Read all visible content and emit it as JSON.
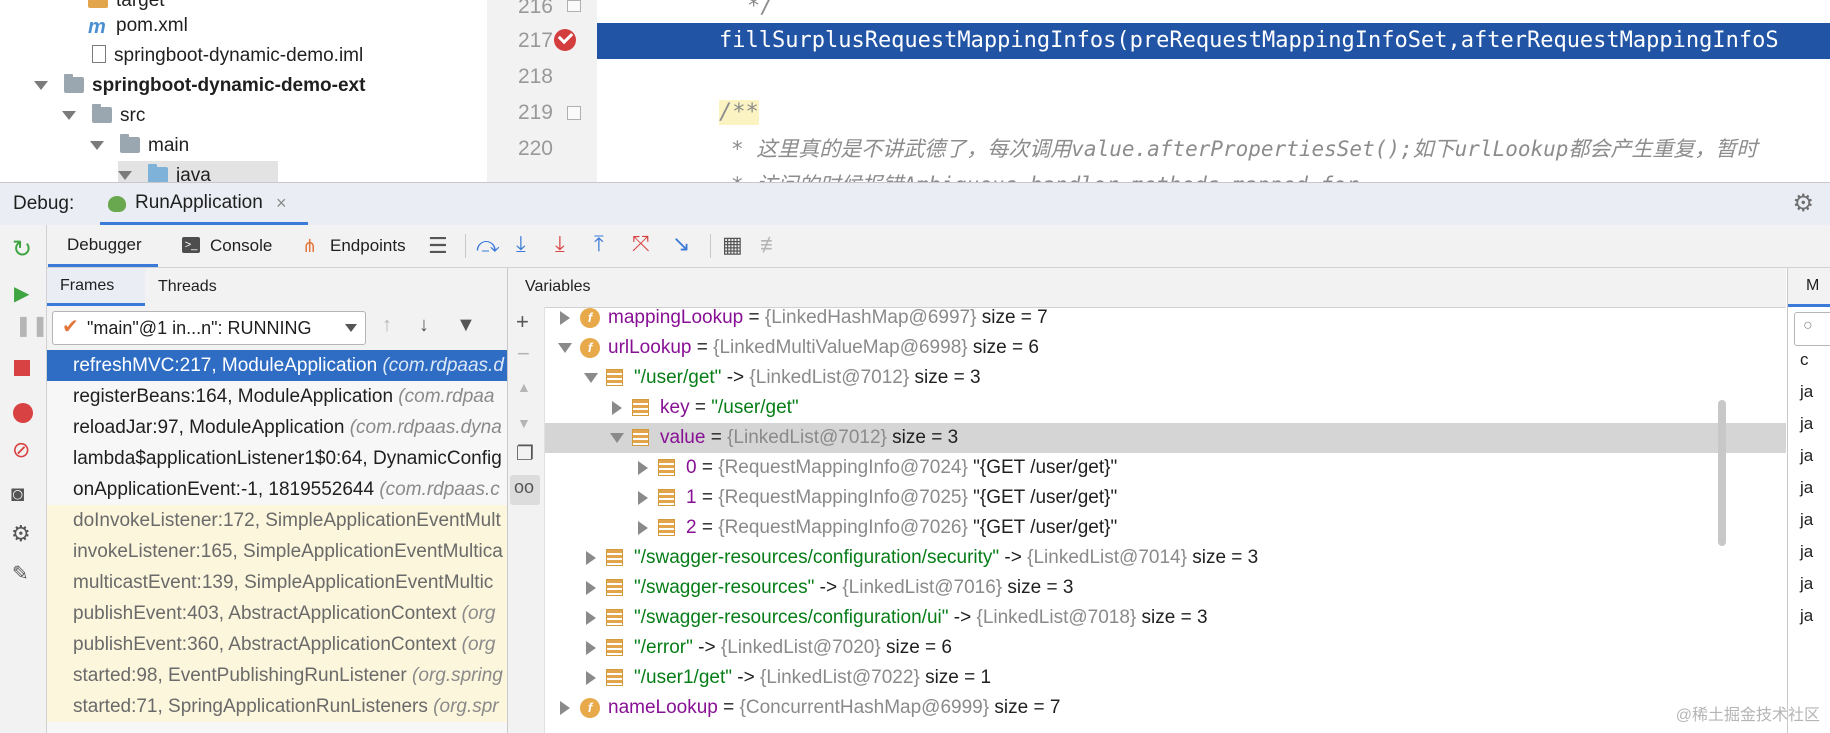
{
  "project_tree": {
    "items": [
      {
        "label": "target",
        "icon": "folder-orange-icon"
      },
      {
        "label": "pom.xml",
        "icon": "maven-icon"
      },
      {
        "label": "springboot-dynamic-demo.iml",
        "icon": "module-file-icon"
      },
      {
        "label": "springboot-dynamic-demo-ext",
        "icon": "module-folder-icon"
      },
      {
        "label": "src",
        "icon": "folder-icon"
      },
      {
        "label": "main",
        "icon": "folder-icon"
      },
      {
        "label": "java",
        "icon": "source-folder-icon"
      }
    ]
  },
  "editor": {
    "line_numbers": [
      "216",
      "217",
      "218",
      "219",
      "220"
    ],
    "lines": [
      "*/",
      "fillSurplusRequestMappingInfos(preRequestMappingInfoSet,afterRequestMappingInfoS",
      "",
      "/**",
      "* 这里真的是不讲武德了，每次调用value.afterPropertiesSet();如下urlLookup都会产生重复，暂时",
      "* 访问的时候报错Ambiguous handler methods mapped for"
    ],
    "breakpoint_line": "217"
  },
  "debug": {
    "title": "Debug:",
    "session_tab": "RunApplication",
    "tabs": [
      "Debugger",
      "Console",
      "Endpoints"
    ],
    "subtabs": [
      "Frames",
      "Threads"
    ],
    "variables_title": "Variables",
    "memory_tab": "M",
    "thread_selector": "\"main\"@1 in...n\": RUNNING"
  },
  "frames": [
    {
      "method": "refreshMVC:217, ModuleApplication",
      "pkg": "(com.rdpaas.d",
      "selected": true
    },
    {
      "method": "registerBeans:164, ModuleApplication",
      "pkg": "(com.rdpaa"
    },
    {
      "method": "reloadJar:97, ModuleApplication",
      "pkg": "(com.rdpaas.dyna"
    },
    {
      "method": "lambda$applicationListener1$0:64, DynamicConfig",
      "pkg": ""
    },
    {
      "method": "onApplicationEvent:-1, 1819552644",
      "pkg": "(com.rdpaas.c"
    },
    {
      "method": "doInvokeListener:172, SimpleApplicationEventMult",
      "pkg": "",
      "lib": true
    },
    {
      "method": "invokeListener:165, SimpleApplicationEventMultica",
      "pkg": "",
      "lib": true
    },
    {
      "method": "multicastEvent:139, SimpleApplicationEventMultic",
      "pkg": "",
      "lib": true
    },
    {
      "method": "publishEvent:403, AbstractApplicationContext",
      "pkg": "(org",
      "lib": true
    },
    {
      "method": "publishEvent:360, AbstractApplicationContext",
      "pkg": "(org",
      "lib": true
    },
    {
      "method": "started:98, EventPublishingRunListener",
      "pkg": "(org.spring",
      "lib": true
    },
    {
      "method": "started:71, SpringApplicationRunListeners",
      "pkg": "(org.spr",
      "lib": true
    }
  ],
  "variables": [
    {
      "indent": 0,
      "arrow": "right",
      "icon": "field",
      "name": "mappingLookup",
      "eq": " = ",
      "type": "{LinkedHashMap@6997}",
      "extra": "  size = 7"
    },
    {
      "indent": 0,
      "arrow": "down",
      "icon": "field",
      "name": "urlLookup",
      "eq": " = ",
      "type": "{LinkedMultiValueMap@6998}",
      "extra": "  size = 6"
    },
    {
      "indent": 1,
      "arrow": "down",
      "icon": "list",
      "str": "\"/user/get\"",
      "eq": " -> ",
      "type": "{LinkedList@7012}",
      "extra": "  size = 3"
    },
    {
      "indent": 2,
      "arrow": "right",
      "icon": "list",
      "name": "key",
      "eq": " = ",
      "str": "\"/user/get\""
    },
    {
      "indent": 2,
      "arrow": "down",
      "icon": "list",
      "name": "value",
      "eq": " = ",
      "type": "{LinkedList@7012}",
      "extra": "  size = 3",
      "selected": true
    },
    {
      "indent": 3,
      "arrow": "right",
      "icon": "list",
      "plain": "0",
      "eq": " = ",
      "type": "{RequestMappingInfo@7024}",
      "extra": " \"{GET /user/get}\""
    },
    {
      "indent": 3,
      "arrow": "right",
      "icon": "list",
      "plain": "1",
      "eq": " = ",
      "type": "{RequestMappingInfo@7025}",
      "extra": " \"{GET /user/get}\""
    },
    {
      "indent": 3,
      "arrow": "right",
      "icon": "list",
      "plain": "2",
      "eq": " = ",
      "type": "{RequestMappingInfo@7026}",
      "extra": " \"{GET /user/get}\""
    },
    {
      "indent": 1,
      "arrow": "right",
      "icon": "list",
      "str": "\"/swagger-resources/configuration/security\"",
      "eq": " -> ",
      "type": "{LinkedList@7014}",
      "extra": "  size = 3"
    },
    {
      "indent": 1,
      "arrow": "right",
      "icon": "list",
      "str": "\"/swagger-resources\"",
      "eq": " -> ",
      "type": "{LinkedList@7016}",
      "extra": "  size = 3"
    },
    {
      "indent": 1,
      "arrow": "right",
      "icon": "list",
      "str": "\"/swagger-resources/configuration/ui\"",
      "eq": " -> ",
      "type": "{LinkedList@7018}",
      "extra": "  size = 3"
    },
    {
      "indent": 1,
      "arrow": "right",
      "icon": "list",
      "str": "\"/error\"",
      "eq": " -> ",
      "type": "{LinkedList@7020}",
      "extra": "  size = 6"
    },
    {
      "indent": 1,
      "arrow": "right",
      "icon": "list",
      "str": "\"/user1/get\"",
      "eq": " -> ",
      "type": "{LinkedList@7022}",
      "extra": "  size = 1"
    },
    {
      "indent": 0,
      "arrow": "right",
      "icon": "field",
      "name": "nameLookup",
      "eq": " = ",
      "type": "{ConcurrentHashMap@6999}",
      "extra": "  size = 7"
    }
  ],
  "memory_rows": [
    "c",
    "ja",
    "ja",
    "ja",
    "ja",
    "ja",
    "ja",
    "ja",
    "ja"
  ],
  "watermark": "@稀土掘金技术社区",
  "colors": {
    "selection_blue": "#2f6dc4",
    "editor_highlight": "#2154a5",
    "string_green": "#067d17",
    "field_purple": "#871094"
  }
}
